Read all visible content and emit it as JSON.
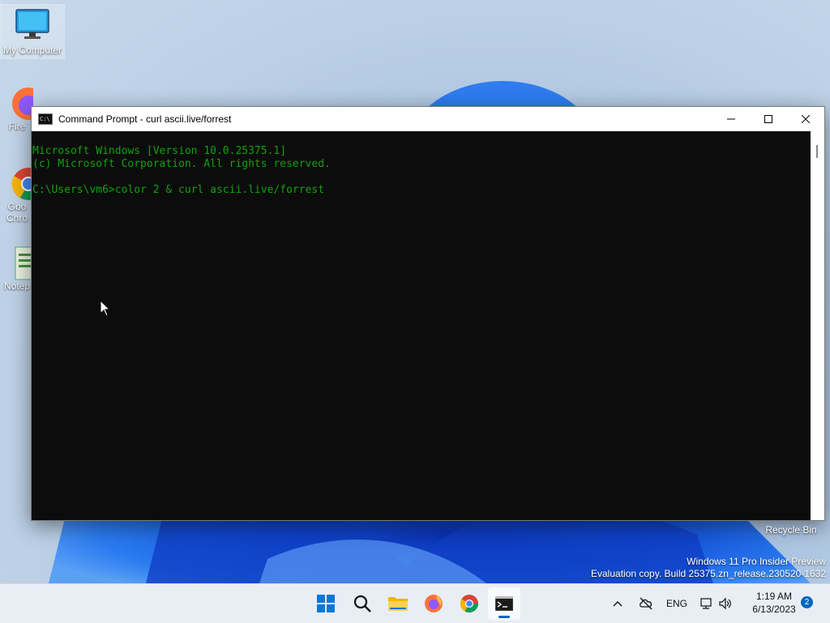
{
  "desktop": {
    "icons": [
      {
        "label": "My Computer"
      },
      {
        "label": "Fire"
      },
      {
        "label": "Goo Chro"
      },
      {
        "label": "Notep"
      }
    ],
    "recycle_bin": "Recycle Bin",
    "watermark": {
      "line1": "Windows 11 Pro Insider Preview",
      "line2": "Evaluation copy. Build 25375.zn_release.230520-1632"
    }
  },
  "window": {
    "title": "Command Prompt - curl  ascii.live/forrest",
    "console_lines": [
      "Microsoft Windows [Version 10.0.25375.1]",
      "(c) Microsoft Corporation. All rights reserved.",
      "",
      "C:\\Users\\vm6>color 2 & curl ascii.live/forrest"
    ],
    "text_color": "#13a10e",
    "background_color": "#0c0c0c"
  },
  "taskbar": {
    "apps": [
      "start-icon",
      "search-icon",
      "file-explorer-icon",
      "firefox-icon",
      "chrome-icon",
      "command-prompt-icon"
    ],
    "active_app": "command-prompt-icon",
    "language": "ENG",
    "time": "1:19 AM",
    "date": "6/13/2023",
    "notification_count": "2"
  }
}
